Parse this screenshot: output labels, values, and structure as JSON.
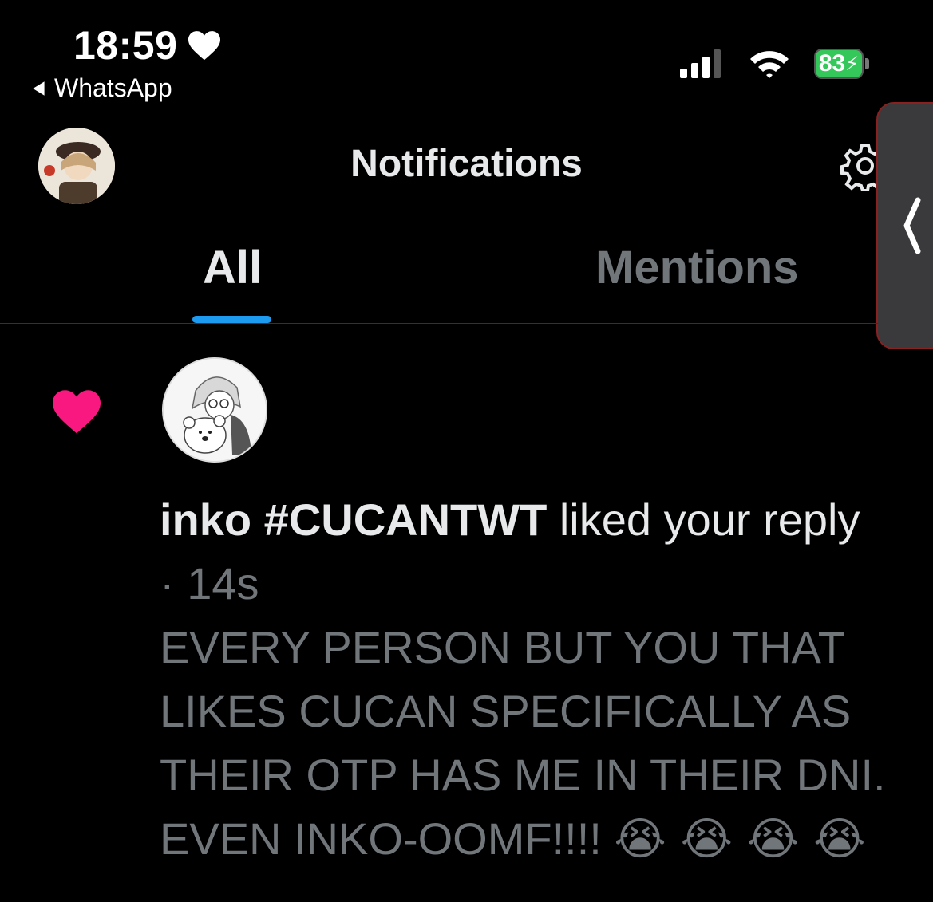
{
  "status_bar": {
    "time": "18:59",
    "back_app": "WhatsApp",
    "battery": "83"
  },
  "header": {
    "title": "Notifications"
  },
  "tabs": [
    {
      "label": "All",
      "active": true
    },
    {
      "label": "Mentions",
      "active": false
    }
  ],
  "notification": {
    "user": "inko #CUCANTWT",
    "action": " liked your reply",
    "time": " · 14s",
    "quote": "EVERY PERSON BUT YOU THAT LIKES CUCAN SPECIFICALLY AS THEIR OTP HAS ME IN THEIR DNI. EVEN INKO-OOMF!!!!",
    "quote_emojis": "😭 😭 😭 😭"
  },
  "colors": {
    "background": "#000000",
    "accent": "#1d9bf0",
    "like": "#f91880",
    "muted": "#71767b",
    "battery": "#34c759"
  },
  "icons": [
    "heart-icon",
    "back-arrow-icon",
    "cellular-signal-icon",
    "wifi-icon",
    "battery-icon",
    "settings-gear-icon",
    "chevron-left-icon",
    "like-heart-icon"
  ]
}
